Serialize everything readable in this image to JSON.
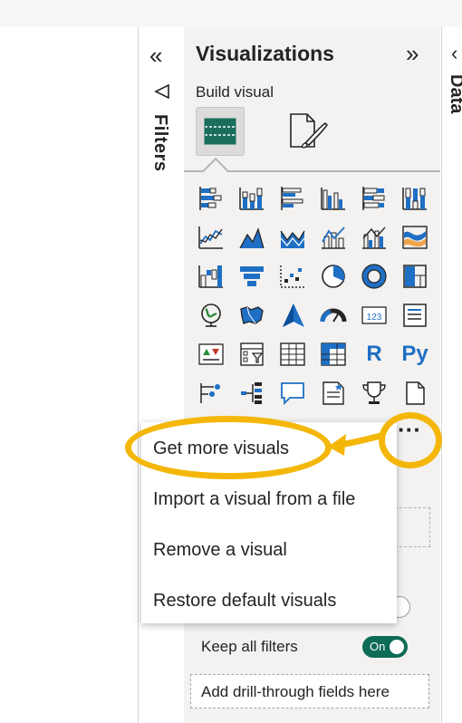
{
  "filters": {
    "label": "Filters",
    "collapse_icon": "double-chevron-left"
  },
  "visualizations": {
    "title": "Visualizations",
    "expand_icon": "double-chevron-right",
    "build_label": "Build visual",
    "tabs": [
      {
        "name": "build-visual",
        "icon": "grid-table"
      },
      {
        "name": "format-visual",
        "icon": "paintbrush-page"
      }
    ],
    "r_label": "R",
    "py_label": "Py",
    "kpi_label": "123",
    "more_label": "···"
  },
  "menu": {
    "items": [
      {
        "label": "Get more visuals"
      },
      {
        "label": "Import a visual from a file"
      },
      {
        "label": "Remove a visual"
      },
      {
        "label": "Restore default visuals"
      }
    ]
  },
  "drillthrough": {
    "keep_filters_label": "Keep all filters",
    "toggle_text": "On",
    "add_fields_placeholder": "Add drill-through fields here"
  },
  "data_pane": {
    "label": "Data",
    "collapse_icon": "chevron-left"
  },
  "colors": {
    "accent_blue": "#1f6fc5",
    "teal": "#0e6b55",
    "highlight": "#f4b709"
  }
}
